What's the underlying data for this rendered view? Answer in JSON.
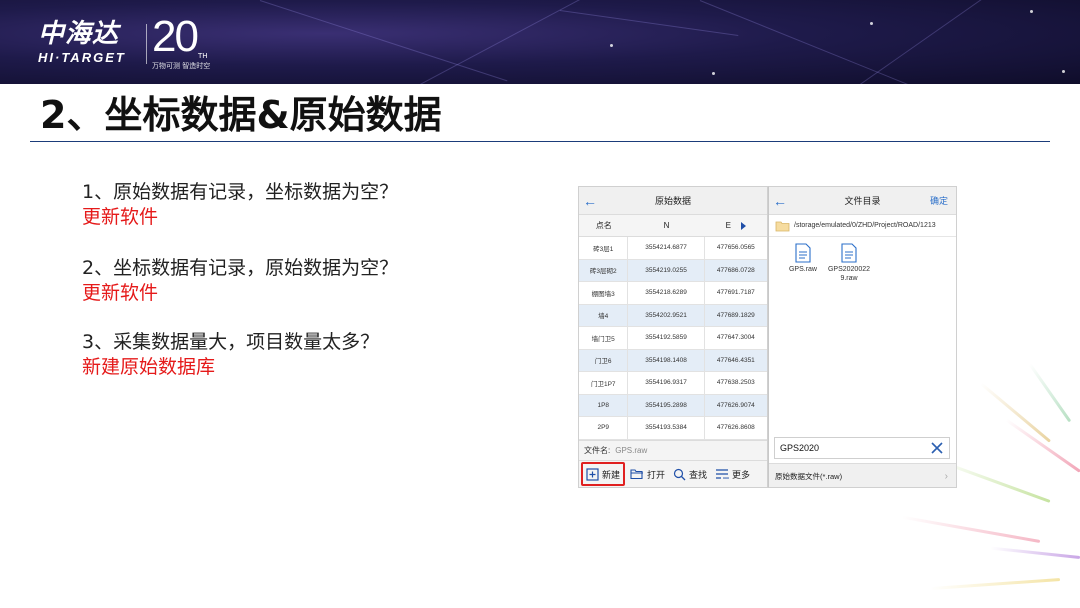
{
  "brand": {
    "logo_cn": "中海达",
    "logo_en": "HI·TARGET",
    "anniversary_number": "20",
    "anniversary_suffix": "TH",
    "anniversary_slogan": "万物可测  智造时空"
  },
  "slide": {
    "title": "2、坐标数据&原始数据",
    "qa": [
      {
        "question": "1、原始数据有记录，坐标数据为空？",
        "answer": "更新软件"
      },
      {
        "question": "2、坐标数据有记录，原始数据为空？",
        "answer": "更新软件"
      },
      {
        "question": "3、采集数据量大，项目数量太多？",
        "answer": "新建原始数据库"
      }
    ]
  },
  "raw_data_screen": {
    "title": "原始数据",
    "back_icon": "back-arrow-icon",
    "columns": [
      "点名",
      "N",
      "E"
    ],
    "rows": [
      {
        "name": "砖3层1",
        "n": "3554214.6877",
        "e": "477656.0565"
      },
      {
        "name": "砖3层砌2",
        "n": "3554219.0255",
        "e": "477686.0728"
      },
      {
        "name": "棚图墙3",
        "n": "3554218.6289",
        "e": "477691.7187"
      },
      {
        "name": "墙4",
        "n": "3554202.9521",
        "e": "477689.1829"
      },
      {
        "name": "墙门卫5",
        "n": "3554192.5859",
        "e": "477647.3004"
      },
      {
        "name": "门卫6",
        "n": "3554198.1408",
        "e": "477646.4351"
      },
      {
        "name": "门卫1P7",
        "n": "3554196.9317",
        "e": "477638.2503"
      },
      {
        "name": "1P8",
        "n": "3554195.2898",
        "e": "477626.9074"
      },
      {
        "name": "2P9",
        "n": "3554193.5384",
        "e": "477626.8608"
      }
    ],
    "filename_label": "文件名:",
    "filename_value": "GPS.raw",
    "toolbar": [
      {
        "label": "新建",
        "icon": "add-square-icon",
        "highlighted": true
      },
      {
        "label": "打开",
        "icon": "folder-open-icon",
        "highlighted": false
      },
      {
        "label": "查找",
        "icon": "search-icon",
        "highlighted": false
      },
      {
        "label": "更多",
        "icon": "more-list-icon",
        "highlighted": false
      }
    ]
  },
  "file_dir_screen": {
    "title": "文件目录",
    "confirm_label": "确定",
    "path": "/storage/emulated/0/ZHD/Project/ROAD/1213",
    "files": [
      {
        "name": "GPS.raw",
        "icon": "file-icon"
      },
      {
        "name": "GPS20200229.raw",
        "icon": "file-icon"
      }
    ],
    "filename_input_value": "GPS2020",
    "file_type_label": "原始数据文件(*.raw)"
  },
  "colors": {
    "banner_bg": "#1e1a4a",
    "answer_red": "#e51a1a",
    "accent_blue": "#2b6fc9",
    "highlight_border": "#e02020"
  }
}
